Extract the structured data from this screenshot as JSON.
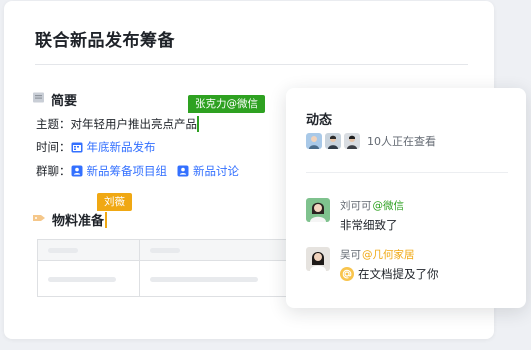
{
  "doc": {
    "title": "联合新品发布筹备",
    "summary": {
      "heading": "简要",
      "topic_label": "主题：",
      "topic_value": "对年轻用户推出亮点产品",
      "time_label": "时间：",
      "time_value": "年底新品发布",
      "group_label": "群聊：",
      "groups": [
        "新品筹备项目组",
        "新品讨论"
      ]
    },
    "materials": {
      "heading": "物料准备"
    },
    "collaborators": [
      {
        "name": "张克力@微信",
        "color": "#2ea121"
      },
      {
        "name": "刘薇",
        "color": "#f0a813"
      }
    ]
  },
  "panel": {
    "title": "动态",
    "viewers_text": "10人正在查看",
    "activities": [
      {
        "user": "刘可可",
        "source": "@微信",
        "source_color": "#2ea121",
        "message": "非常细致了"
      },
      {
        "user": "吴可",
        "source": "@几何家居",
        "source_color": "#f0a813",
        "message": "在文档提及了你"
      }
    ]
  },
  "colors": {
    "accent": "#3370ff",
    "text": "#1f2329",
    "secondary": "#646a73"
  }
}
